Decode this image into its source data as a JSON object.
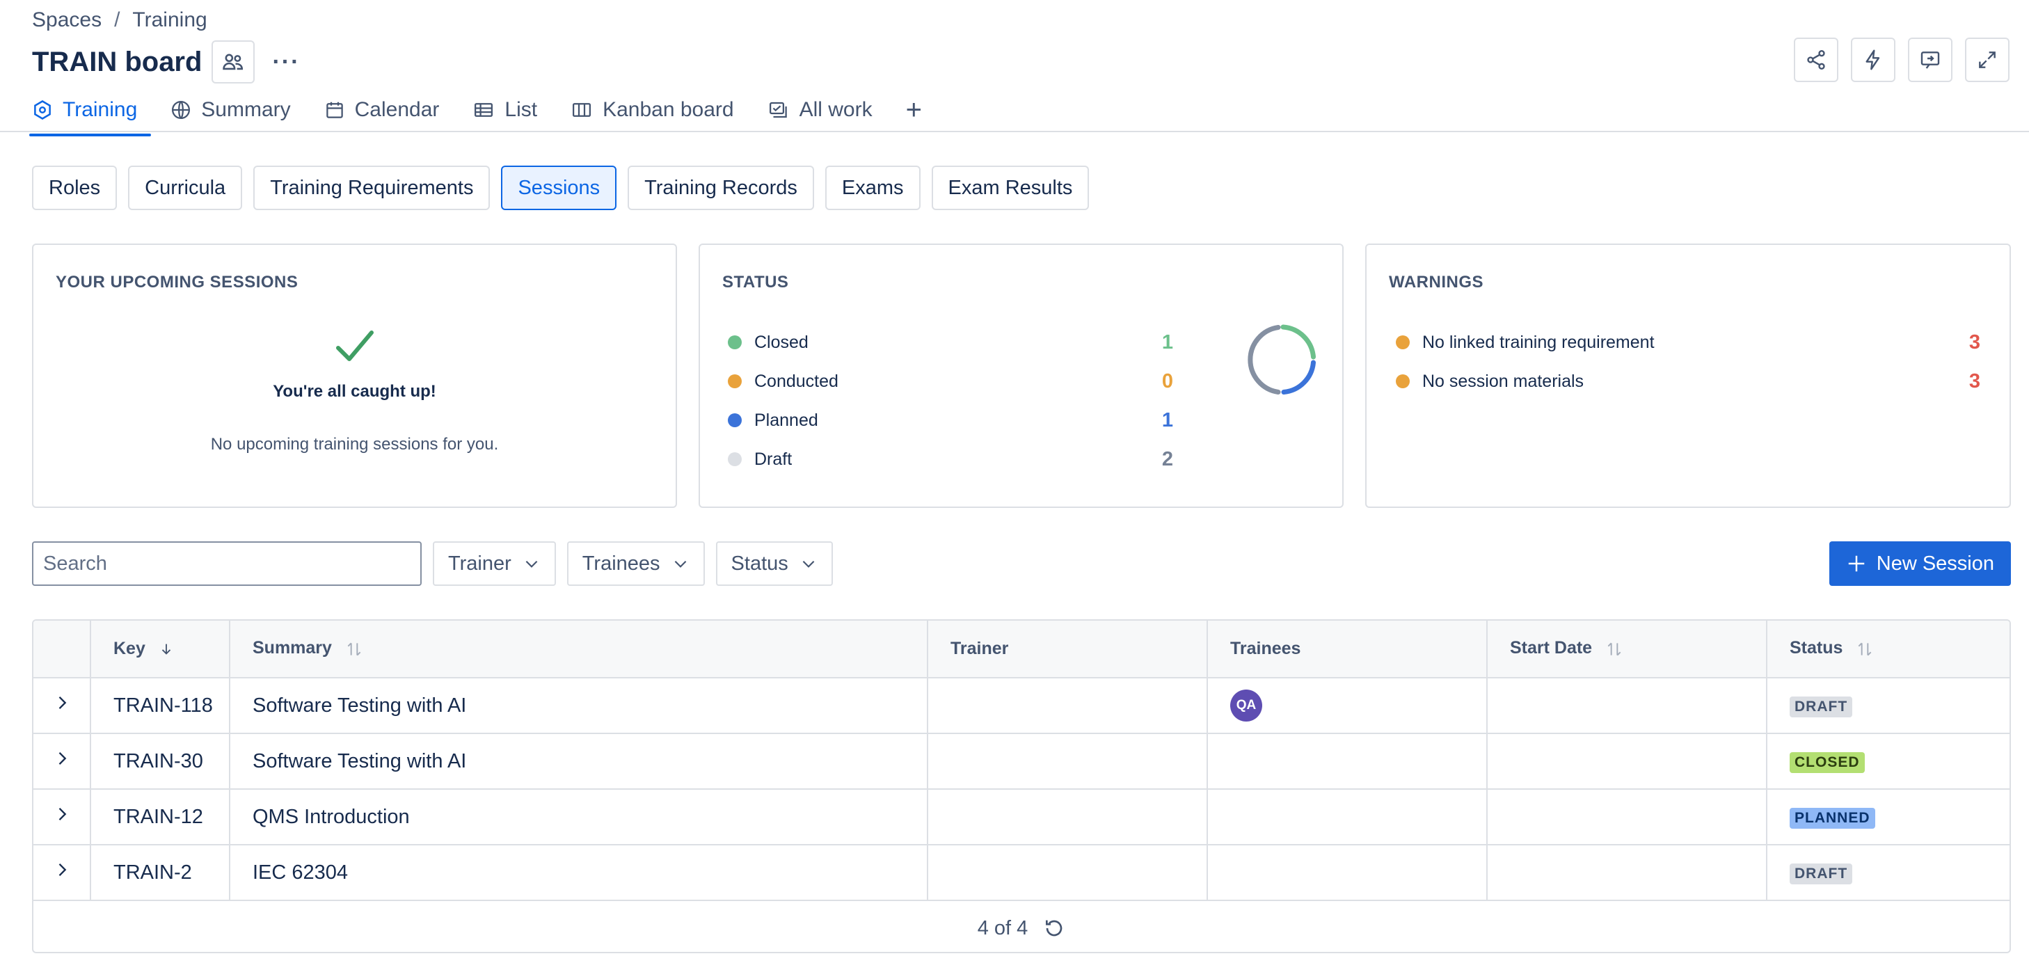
{
  "breadcrumb": {
    "root": "Spaces",
    "separator": "/",
    "current": "Training"
  },
  "header": {
    "title": "TRAIN board",
    "more": "···"
  },
  "tabs": [
    {
      "label": "Training",
      "icon": "hexagon-gear-icon",
      "active": true
    },
    {
      "label": "Summary",
      "icon": "globe-icon"
    },
    {
      "label": "Calendar",
      "icon": "calendar-icon"
    },
    {
      "label": "List",
      "icon": "list-table-icon"
    },
    {
      "label": "Kanban board",
      "icon": "board-icon"
    },
    {
      "label": "All work",
      "icon": "work-items-icon"
    }
  ],
  "tab_add": "+",
  "subnav": [
    "Roles",
    "Curricula",
    "Training Requirements",
    "Sessions",
    "Training Records",
    "Exams",
    "Exam Results"
  ],
  "subnav_active": "Sessions",
  "upcoming": {
    "title": "YOUR UPCOMING SESSIONS",
    "headline": "You're all caught up!",
    "message": "No upcoming training sessions for you."
  },
  "status": {
    "title": "STATUS",
    "items": [
      {
        "label": "Closed",
        "count": "1",
        "color": "#6cc08b"
      },
      {
        "label": "Conducted",
        "count": "0",
        "color": "#e9a23b"
      },
      {
        "label": "Planned",
        "count": "1",
        "color": "#3b73d9"
      },
      {
        "label": "Draft",
        "count": "2",
        "color": "#dcdfe4"
      }
    ],
    "count_colors": [
      "#6cc08b",
      "#e9a23b",
      "#3b73d9",
      "#758195"
    ]
  },
  "warnings": {
    "title": "WARNINGS",
    "items": [
      {
        "label": "No linked training requirement",
        "count": "3"
      },
      {
        "label": "No session materials",
        "count": "3"
      }
    ],
    "dot_color": "#e9a23b",
    "count_color": "#e2574c"
  },
  "filters": {
    "search_placeholder": "Search",
    "trainer": "Trainer",
    "trainees": "Trainees",
    "status": "Status"
  },
  "new_session": "New Session",
  "table": {
    "headers": {
      "key": "Key",
      "summary": "Summary",
      "trainer": "Trainer",
      "trainees": "Trainees",
      "start_date": "Start Date",
      "status": "Status"
    },
    "rows": [
      {
        "key": "TRAIN-118",
        "summary": "Software Testing with AI",
        "trainer": "",
        "trainees": "QA",
        "start_date": "",
        "status": "DRAFT"
      },
      {
        "key": "TRAIN-30",
        "summary": "Software Testing with AI",
        "trainer": "",
        "trainees": "",
        "start_date": "",
        "status": "CLOSED"
      },
      {
        "key": "TRAIN-12",
        "summary": "QMS Introduction",
        "trainer": "",
        "trainees": "",
        "start_date": "",
        "status": "PLANNED"
      },
      {
        "key": "TRAIN-2",
        "summary": "IEC 62304",
        "trainer": "",
        "trainees": "",
        "start_date": "",
        "status": "DRAFT"
      }
    ],
    "footer": "4 of 4"
  }
}
